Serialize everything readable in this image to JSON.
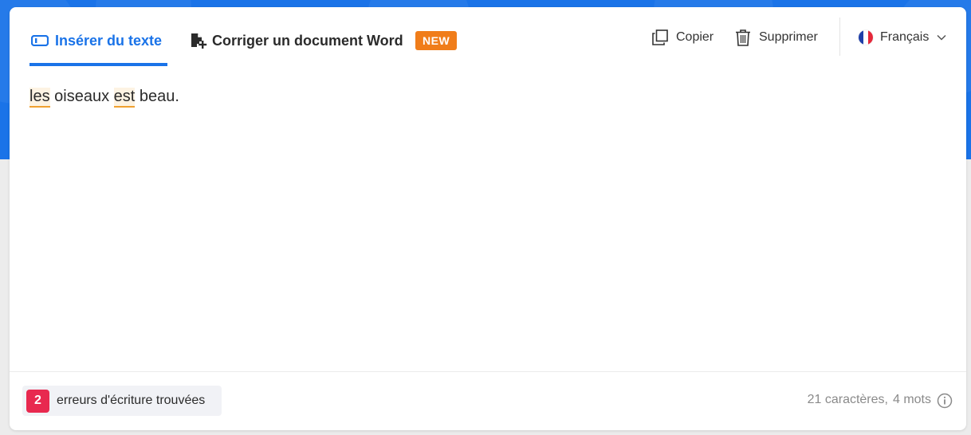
{
  "colors": {
    "brand_blue": "#1a73e8",
    "new_badge": "#f07d1a",
    "error_badge": "#e8294f",
    "error_underline": "#f0a030"
  },
  "tabs": {
    "insert_text": {
      "label": "Insérer du texte",
      "icon": "textfield-icon",
      "active": true
    },
    "correct_word": {
      "label": "Corriger un document Word",
      "icon": "document-add-icon",
      "badge": "NEW"
    }
  },
  "toolbar": {
    "copy_label": "Copier",
    "copy_icon": "copy-icon",
    "delete_label": "Supprimer",
    "delete_icon": "trash-icon"
  },
  "language": {
    "selected": "Français",
    "flag": "french-flag-icon"
  },
  "editor": {
    "segments": [
      {
        "text": "les",
        "error": true
      },
      {
        "text": " oiseaux ",
        "error": false
      },
      {
        "text": "est",
        "error": true
      },
      {
        "text": " beau.",
        "error": false
      }
    ]
  },
  "footer": {
    "error_count": "2",
    "error_label": "erreurs d'écriture trouvées",
    "characters": "21 caractères,",
    "words": "4 mots"
  }
}
